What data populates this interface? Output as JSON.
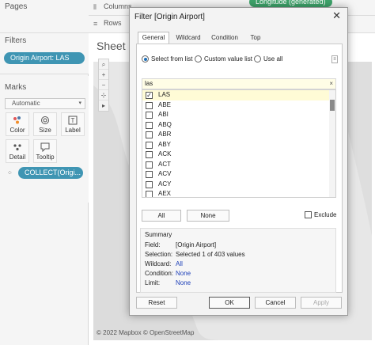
{
  "left_panel": {
    "pages_title": "Pages",
    "filters_title": "Filters",
    "filter_pill": "Origin Airport: LAS",
    "marks_title": "Marks",
    "marks_type": "Automatic",
    "mark_buttons": [
      {
        "label": "Color",
        "icon": "color-dots-icon"
      },
      {
        "label": "Size",
        "icon": "size-icon"
      },
      {
        "label": "Label",
        "icon": "label-icon"
      },
      {
        "label": "Detail",
        "icon": "detail-icon"
      },
      {
        "label": "Tooltip",
        "icon": "tooltip-icon"
      }
    ],
    "marks_pill": "COLLECT(Origi..."
  },
  "shelves": {
    "columns_label": "Columns",
    "rows_label": "Rows",
    "columns_pill": "Longitude (generated)"
  },
  "canvas": {
    "sheet_title": "Sheet",
    "attribution": "© 2022 Mapbox © OpenStreetMap"
  },
  "dialog": {
    "title": "Filter [Origin Airport]",
    "close_glyph": "✕",
    "tabs": [
      "General",
      "Wildcard",
      "Condition",
      "Top"
    ],
    "active_tab": "General",
    "radios": [
      {
        "label": "Select from list",
        "selected": true
      },
      {
        "label": "Custom value list",
        "selected": false
      },
      {
        "label": "Use all",
        "selected": false
      }
    ],
    "search_value": "las",
    "search_clear": "×",
    "list_items": [
      {
        "label": "LAS",
        "checked": true
      },
      {
        "label": "ABE",
        "checked": false
      },
      {
        "label": "ABI",
        "checked": false
      },
      {
        "label": "ABQ",
        "checked": false
      },
      {
        "label": "ABR",
        "checked": false
      },
      {
        "label": "ABY",
        "checked": false
      },
      {
        "label": "ACK",
        "checked": false
      },
      {
        "label": "ACT",
        "checked": false
      },
      {
        "label": "ACV",
        "checked": false
      },
      {
        "label": "ACY",
        "checked": false
      },
      {
        "label": "AEX",
        "checked": false
      }
    ],
    "all_button": "All",
    "none_button": "None",
    "exclude_label": "Exclude",
    "summary": {
      "title": "Summary",
      "rows": [
        {
          "key": "Field:",
          "value": "[Origin Airport]",
          "link": false
        },
        {
          "key": "Selection:",
          "value": "Selected 1 of 403 values",
          "link": false
        },
        {
          "key": "Wildcard:",
          "value": "All",
          "link": true
        },
        {
          "key": "Condition:",
          "value": "None",
          "link": true
        },
        {
          "key": "Limit:",
          "value": "None",
          "link": true
        }
      ]
    },
    "buttons": {
      "reset": "Reset",
      "ok": "OK",
      "cancel": "Cancel",
      "apply": "Apply"
    }
  }
}
